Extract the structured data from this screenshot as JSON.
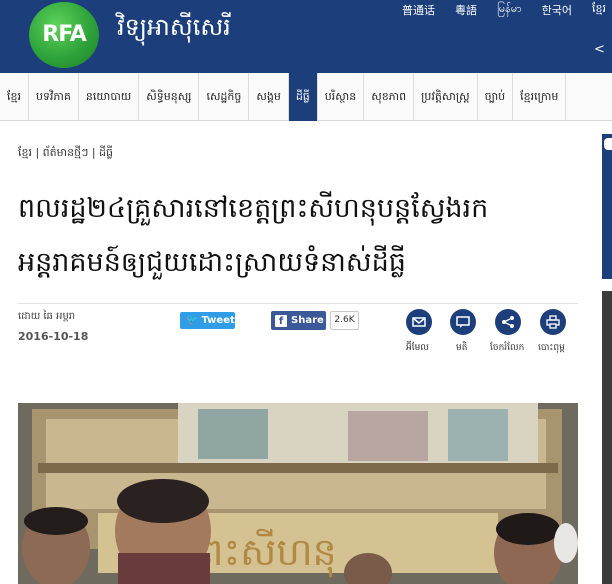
{
  "header": {
    "logo_text": "RFA",
    "site_name": "វិទ្យុអាស៊ីសេរី",
    "languages": [
      "普通话",
      "粵語",
      "မြန်မာ",
      "한국어",
      "ខ្មែរ"
    ],
    "bg_color": "#1c3f7c",
    "logo_color": "#2ea33a"
  },
  "nav": {
    "items": [
      {
        "label": "ខ្មែរ"
      },
      {
        "label": "បទវិភាគ"
      },
      {
        "label": "នយោបាយ"
      },
      {
        "label": "សិទ្ធិមនុស្ស"
      },
      {
        "label": "សេដ្ឋកិច្ច"
      },
      {
        "label": "សង្គម"
      },
      {
        "label": "ដីធ្លី"
      },
      {
        "label": "បរិស្ថាន"
      },
      {
        "label": "សុខភាព"
      },
      {
        "label": "ប្រវត្តិសាស្ត្រ"
      },
      {
        "label": "ច្បាប់"
      },
      {
        "label": "ខ្មែរក្រោម"
      }
    ],
    "active_index": 6
  },
  "breadcrumb": "ខ្មែរ | ព័ត៌មានថ្មីៗ | ដីធ្លី",
  "article": {
    "title_line1": "ពលរដ្ឋ២៤គ្រួសារនៅខេត្តព្រះសីហនុបន្តស្វែងរក",
    "title_line2": "អន្តរាគមន៍ឲ្យជួយដោះស្រាយទំនាស់ដីធ្លី",
    "author": "ដោយ ឆៃ អម្ពរា",
    "date": "2016-10-18"
  },
  "social": {
    "tweet_label": "Tweet",
    "share_label": "Share",
    "share_count": "2.6K"
  },
  "tools": [
    {
      "icon": "envelope-icon",
      "label": "អ៊ីមែល"
    },
    {
      "icon": "comment-icon",
      "label": "មតិ"
    },
    {
      "icon": "share-icon",
      "label": "ចែករំលែក"
    },
    {
      "icon": "printer-icon",
      "label": "បោះពុម្ព"
    }
  ],
  "photo": {
    "sign_text": "ព្រះសីហនុ"
  }
}
